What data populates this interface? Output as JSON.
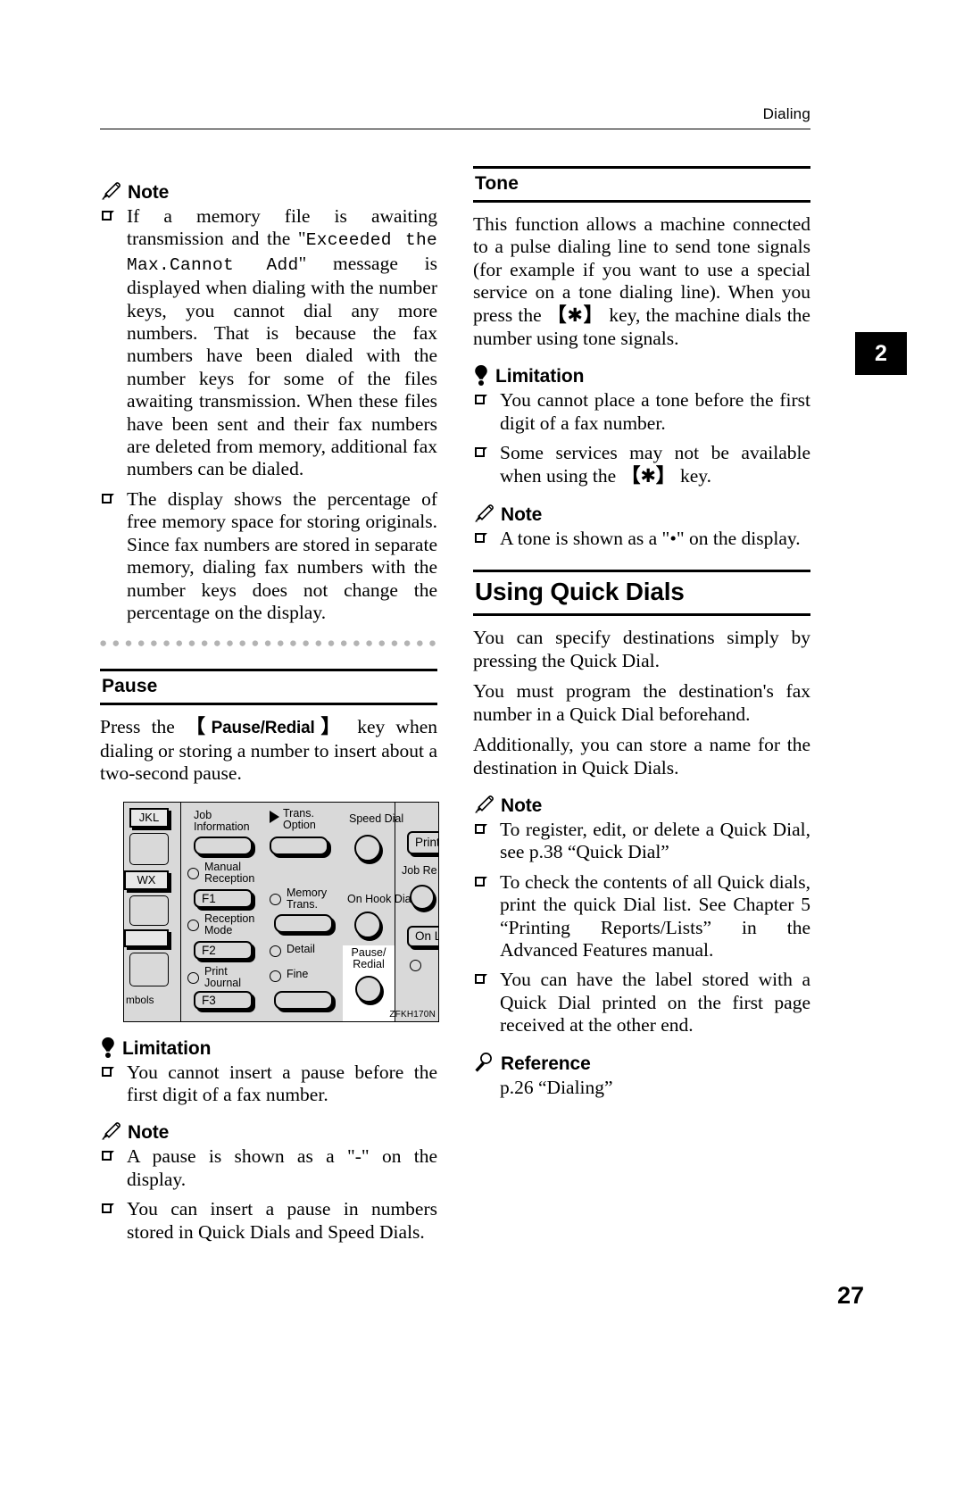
{
  "header": {
    "title": "Dialing"
  },
  "chapter_tab": {
    "number": "2"
  },
  "folio": {
    "page_number": "27"
  },
  "icons": {
    "note": "pencil-icon",
    "limitation": "exclamation-bulb-icon",
    "reference": "magnifier-icon"
  },
  "left_column": {
    "note_1": {
      "label": "Note",
      "items": [
        {
          "pre": "If a memory file is awaiting transmission and the \"",
          "mono1": "Exceeded the Max.Cannot Add",
          "post": "\" message is displayed when dialing with the number keys, you cannot dial any more numbers. That is because the fax numbers have been dialed with the number keys for some of the files awaiting transmission. When these files have been sent and their fax numbers are deleted from memory, additional fax numbers can be dialed."
        },
        {
          "text": "The display shows the percentage of free memory space for storing originals. Since fax numbers are stored in separate memory, dialing fax numbers with the number keys does not change the percentage on the display."
        }
      ]
    },
    "pause_section": {
      "heading": "Pause",
      "intro_pre": "Press the ",
      "intro_key": "Pause/Redial",
      "intro_post": " key when dialing or storing a number to insert about a two-second pause.",
      "figure": {
        "code": "ZFKH170N",
        "labels": {
          "jkl": "JKL",
          "wx": "WX",
          "symbols": "mbols",
          "job_information": "Job\nInformation",
          "trans_option": "Trans.\nOption",
          "speed_dial": "Speed Dial",
          "manual_reception": "Manual\nReception",
          "f1": "F1",
          "memory_trans": "Memory\nTrans.",
          "on_hook_dial": "On Hook Dial",
          "reception_mode": "Reception\nMode",
          "f2": "F2",
          "detail": "Detail",
          "print_journal": "Print\nJournal",
          "fine": "Fine",
          "f3": "F3",
          "pause_redial": "Pause/\nRedial",
          "print": "Print",
          "job_re": "Job Re",
          "on_li": "On Li"
        }
      },
      "limitation": {
        "label": "Limitation",
        "items": [
          "You cannot insert a pause before the first digit of a fax number."
        ]
      },
      "note": {
        "label": "Note",
        "items": [
          "A pause is shown as a \"-\" on the display.",
          "You can insert a pause in numbers stored in Quick Dials and Speed Dials."
        ]
      }
    }
  },
  "right_column": {
    "tone_section": {
      "heading": "Tone",
      "intro_pre": "This function allows a machine connected to a pulse dialing line to send tone signals (for example if you want to use a special service on a tone dialing line). When you press the ",
      "intro_key": "✱",
      "intro_post": " key, the machine dials the number using tone signals.",
      "limitation": {
        "label": "Limitation",
        "items": [
          {
            "text": "You cannot place a tone before the first digit of a fax number."
          },
          {
            "pre": "Some services may not be available when using the ",
            "key": "✱",
            "post": " key."
          }
        ]
      },
      "note": {
        "label": "Note",
        "items": [
          "A tone is shown as a \"•\" on the display."
        ]
      }
    },
    "quick_dials_section": {
      "heading": "Using Quick Dials",
      "paragraphs": [
        "You can specify destinations simply by pressing the Quick Dial.",
        "You must program the destination's fax number in a Quick Dial beforehand.",
        "Additionally, you can store a name for the destination in Quick Dials."
      ],
      "note": {
        "label": "Note",
        "items": [
          "To register, edit, or delete a Quick Dial, see p.38 “Quick Dial”",
          "To check the contents of all Quick dials, print the quick Dial list. See Chapter 5 “Printing Reports/Lists” in the Advanced Features manual.",
          "You can have the label stored with a Quick Dial printed on the first page received at the other end."
        ]
      },
      "reference": {
        "label": "Reference",
        "text": "p.26 “Dialing”"
      }
    }
  }
}
